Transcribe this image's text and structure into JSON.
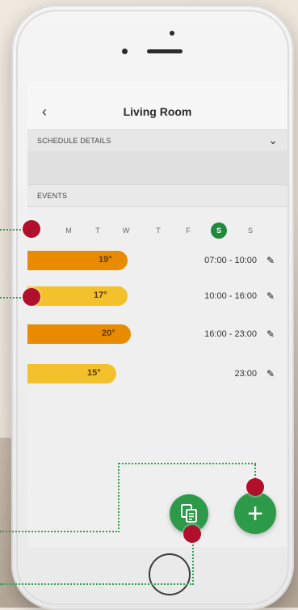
{
  "screen": {
    "title": "Living Room",
    "back_icon": "‹",
    "sections": {
      "schedule_details": "SCHEDULE DETAILS",
      "events": "EVENTS"
    },
    "chevron_icon": "⌄"
  },
  "days": [
    {
      "label": "M",
      "selected": false
    },
    {
      "label": "T",
      "selected": false
    },
    {
      "label": "W",
      "selected": false
    },
    {
      "label": "T",
      "selected": false
    },
    {
      "label": "F",
      "selected": false
    },
    {
      "label": "S",
      "selected": true
    },
    {
      "label": "S",
      "selected": false
    }
  ],
  "events": [
    {
      "temp": "19°",
      "time": "07:00 - 10:00",
      "color": "#e98b00"
    },
    {
      "temp": "17°",
      "time": "10:00 - 16:00",
      "color": "#f2c12c"
    },
    {
      "temp": "20°",
      "time": "16:00 - 23:00",
      "color": "#e98b00"
    },
    {
      "temp": "15°",
      "time": "23:00",
      "color": "#f2c12c"
    }
  ],
  "fab": {
    "add_icon": "+",
    "copy_icon": "copy-icon"
  },
  "colors": {
    "accent_green": "#2d9a4a",
    "callout_red": "#b0102b",
    "leader_green": "#2fa14b"
  }
}
